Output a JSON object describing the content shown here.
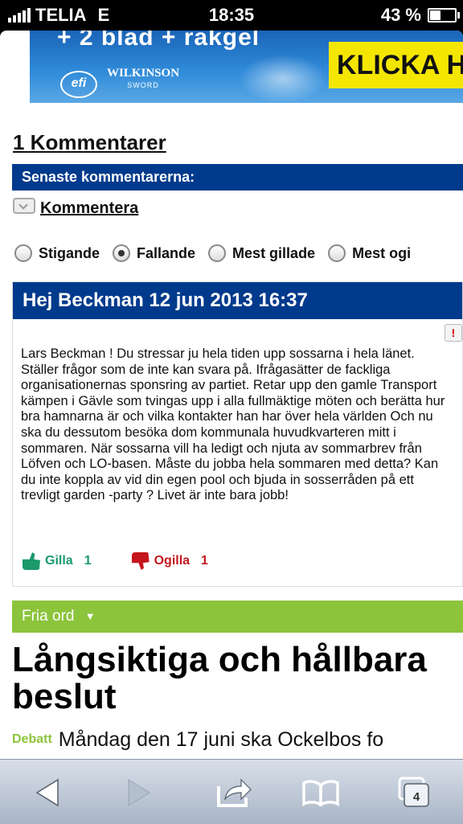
{
  "status_bar": {
    "carrier": "TELIA",
    "network": "E",
    "time": "18:35",
    "battery": "43 %"
  },
  "ad": {
    "headline": "+ 2 blad + rakgel",
    "brand1": "efi",
    "brand2": "WILKINSON",
    "brand2_sub": "SWORD",
    "cta": "KLICKA H"
  },
  "comments": {
    "count_title": "1 Kommentarer",
    "section_bar": "Senaste kommentarerna:",
    "comment_link": "Kommentera",
    "sort_options": [
      {
        "label": "Stigande",
        "selected": false
      },
      {
        "label": "Fallande",
        "selected": true
      },
      {
        "label": "Mest gillade",
        "selected": false
      },
      {
        "label": "Mest ogi",
        "selected": false
      }
    ],
    "items": [
      {
        "header": "Hej Beckman 12 jun 2013 16:37",
        "report_icon": "!",
        "body": "Lars Beckman ! Du stressar ju hela tiden upp sossarna i hela länet. Ställer frågor som de inte kan svara på. Ifrågasätter de fackliga organisationernas sponsring av partiet. Retar upp den gamle Transport kämpen i Gävle som tvingas upp i alla fullmäktige möten och berätta hur bra hamnarna är och vilka kontakter han har över hela världen Och nu ska du dessutom besöka dom kommunala huvudkvarteren mitt i sommaren. När sossarna vill ha ledigt och njuta av sommarbrev från Löfven och LO-basen. Måste du jobba hela sommaren med detta? Kan du inte koppla av vid din egen pool och bjuda in sosserråden på ett trevligt garden -party ? Livet är inte bara jobb!",
        "like_label": "Gilla",
        "like_count": "1",
        "dislike_label": "Ogilla",
        "dislike_count": "1"
      }
    ]
  },
  "section": {
    "label": "Fria ord",
    "chevron": "▼"
  },
  "article": {
    "headline": "Långsiktiga och hållbara beslut",
    "tag": "Debatt",
    "teaser": "Måndag den 17 juni ska Ockelbos fo"
  },
  "toolbar": {
    "tabs_count": "4"
  },
  "colors": {
    "brand_blue": "#003a8c",
    "section_green": "#8cc43c",
    "like_green": "#1a9a6a",
    "dislike_red": "#c4161c",
    "ad_yellow": "#f5e600"
  },
  "icons": [
    "signal-icon",
    "battery-icon",
    "comment-bubble-icon",
    "report-flag-icon",
    "thumbs-up-icon",
    "thumbs-down-icon",
    "chevron-down-icon",
    "back-icon",
    "forward-icon",
    "share-icon",
    "bookmarks-icon",
    "tabs-icon"
  ]
}
